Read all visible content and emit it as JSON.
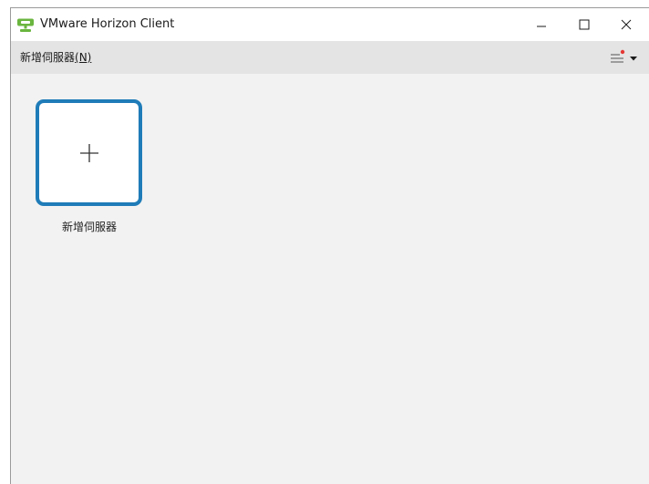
{
  "window": {
    "title": "VMware Horizon Client",
    "controls": {
      "minimize_icon": "minimize-icon",
      "maximize_icon": "maximize-icon",
      "close_icon": "close-icon"
    }
  },
  "toolbar": {
    "add_server_label": "新增伺服器",
    "add_server_mnemonic": "(N)",
    "options_icon": "options-menu-icon",
    "notification_color": "#e53935"
  },
  "servers": {
    "add_tile_label": "新增伺服器",
    "add_tile_icon": "plus-icon",
    "tile_border_color": "#1f7cb8"
  },
  "colors": {
    "logo_green": "#6ab53f",
    "toolbar_bg": "#e4e4e4",
    "content_bg": "#f2f2f2"
  }
}
